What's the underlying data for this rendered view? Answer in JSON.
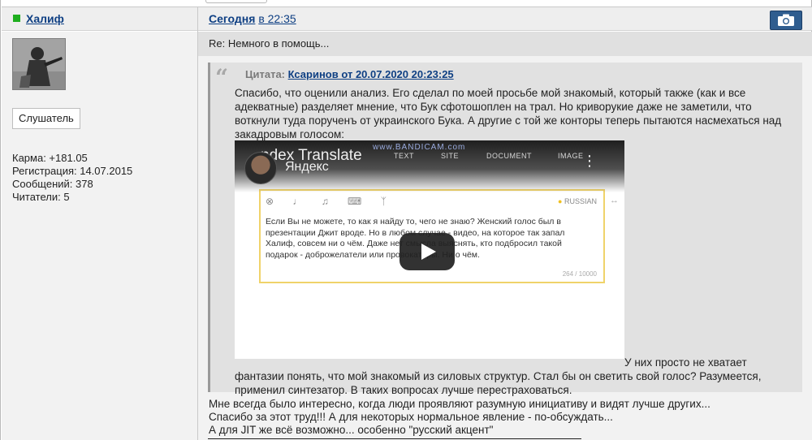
{
  "author": {
    "name": "Халиф",
    "rank": "Слушатель",
    "stats": {
      "karma": "Карма: +181.05",
      "registered": "Регистрация: 14.07.2015",
      "posts": "Сообщений: 378",
      "readers": "Читатели: 5"
    }
  },
  "post": {
    "date_day": "Сегодня",
    "date_time": "в 22:35",
    "subject": "Re: Немного в помощь...",
    "quote": {
      "label": "Цитата:",
      "ref": "Ксаринов от 20.07.2020 20:23:25",
      "text": "Спасибо, что оценили анализ. Его сделал по моей просьбе мой знакомый, который также (как и все адекватные) разделяет мнение, что Бук сфотошоплен на трал. Но криворукие даже не заметили, что воткнули туда порученъ от украинского Бука. А другие с той же конторы теперь пытаются насмехаться над закадровым голосом:",
      "tail_inline": "У них просто не хватает",
      "tail": "фантазии понять, что мой знакомый из силовых структур. Стал бы он светить свой голос? Разумеется, применил синтезатор. В таких вопросах лучше перестраховаться.",
      "video": {
        "logo_text": "ndex Translate",
        "watermark": "www.BANDICAM.com",
        "tabs": [
          "TEXT",
          "SITE",
          "DOCUMENT",
          "IMAGE"
        ],
        "channel": "Яндекс",
        "lang": "RUSSIAN",
        "body": "Если Вы не можете, то как я найду то, чего не знаю? Женский голос был в презентации Джит вроде. Но в любом случае - видео, на которое так запал Халиф, совсем ни о чём. Даже нет смысла выяснять, кто подбросил такой подарок - доброжелатели или провокаторы. Ни о чём.",
        "counter": "264 / 10000"
      }
    },
    "reply_lines": [
      "Мне всегда было интересно, когда люди проявляют разумную инициативу и видят лучше других...",
      "Спасибо за этот труд!!! А для некоторых нормальное явление - по-обсуждать...",
      "А для JIT же всё возможно... особенно \"русский акцент\""
    ]
  },
  "colors": {
    "link": "#0e3f83",
    "online": "#1fae1f",
    "camera_button": "#2f5d8f"
  }
}
